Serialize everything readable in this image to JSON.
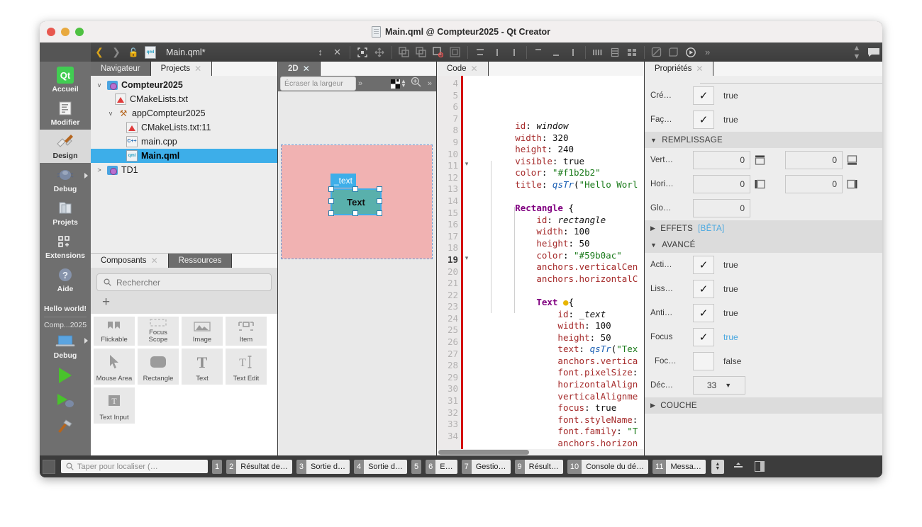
{
  "window": {
    "title": "Main.qml @ Compteur2025 - Qt Creator",
    "traffic": [
      "close",
      "minimize",
      "zoom"
    ]
  },
  "toolbar": {
    "back_icon": "chevron-left-icon",
    "forward_icon": "chevron-right-icon",
    "lock_icon": "unlock-icon",
    "file_icon": "qml-file-icon",
    "filename": "Main.qml*",
    "split_icon": "split-icon",
    "close_icon": "close-icon",
    "icons": [
      "fit-to-view-icon",
      "move-icon",
      "copy-format-icon",
      "paste-format-icon",
      "reset-position-icon",
      "reset-size-icon",
      "align-top-icon",
      "align-vertical-center-icon",
      "align-bottom-icon",
      "distribute-top-icon",
      "distribute-center-icon",
      "distribute-bottom-icon",
      "column-layout-icon",
      "row-layout-icon",
      "grid-layout-icon",
      "edit-annotation-icon",
      "add-state-icon",
      "preview-icon",
      "more-icon",
      "updown-icon",
      "comment-icon"
    ]
  },
  "modebar": {
    "items": [
      {
        "label": "Accueil",
        "icon": "qt-logo-icon",
        "active": false
      },
      {
        "label": "Modifier",
        "icon": "edit-mode-icon",
        "active": false
      },
      {
        "label": "Design",
        "icon": "design-mode-icon",
        "active": true
      },
      {
        "label": "Debug",
        "icon": "debug-mode-icon",
        "active": false
      },
      {
        "label": "Projets",
        "icon": "projects-mode-icon",
        "active": false
      },
      {
        "label": "Extensions",
        "icon": "extensions-mode-icon",
        "active": false
      },
      {
        "label": "Aide",
        "icon": "help-mode-icon",
        "active": false
      }
    ],
    "kit_target": "Hello world!",
    "kit_project": "Comp...2025",
    "run_config": "Debug",
    "run_icon": "run-icon",
    "debug_icon": "run-debug-icon",
    "build_icon": "build-hammer-icon",
    "desktop_icon": "desktop-target-icon"
  },
  "leftdock": {
    "tabs": [
      {
        "label": "Navigateur",
        "selected": false
      },
      {
        "label": "Projects",
        "selected": true
      }
    ],
    "tree": [
      {
        "label": "Compteur2025",
        "indent": 0,
        "twisty": "v",
        "icon": "project-folder-icon",
        "bold": true,
        "selected": false
      },
      {
        "label": "CMakeLists.txt",
        "indent": 1,
        "twisty": "",
        "icon": "cmake-file-icon",
        "bold": false,
        "selected": false
      },
      {
        "label": "appCompteur2025",
        "indent": 1,
        "twisty": "v",
        "icon": "build-target-icon",
        "bold": false,
        "selected": false
      },
      {
        "label": "CMakeLists.txt:11",
        "indent": 2,
        "twisty": "",
        "icon": "cmake-file-icon",
        "bold": false,
        "selected": false
      },
      {
        "label": "main.cpp",
        "indent": 2,
        "twisty": "",
        "icon": "cpp-file-icon",
        "bold": false,
        "selected": false
      },
      {
        "label": "Main.qml",
        "indent": 2,
        "twisty": "",
        "icon": "qml-file-icon",
        "bold": false,
        "selected": true
      },
      {
        "label": "TD1",
        "indent": 0,
        "twisty": ">",
        "icon": "project-folder-icon",
        "bold": false,
        "selected": false
      }
    ]
  },
  "components": {
    "tabs": [
      {
        "label": "Composants",
        "selected": true
      },
      {
        "label": "Ressources",
        "selected": false
      }
    ],
    "search_placeholder": "Rechercher",
    "search_icon": "search-icon",
    "add_icon": "plus-icon",
    "items": [
      {
        "label": "Flickable",
        "icon": "flickable-icon",
        "clipped": true
      },
      {
        "label": "Focus\nScope",
        "icon": "focus-scope-icon",
        "clipped": true
      },
      {
        "label": "Image",
        "icon": "image-icon",
        "clipped": true
      },
      {
        "label": "Item",
        "icon": "item-icon",
        "clipped": true
      },
      {
        "label": "Mouse Area",
        "icon": "mouse-area-icon",
        "clipped": false
      },
      {
        "label": "Rectangle",
        "icon": "rectangle-icon",
        "clipped": false
      },
      {
        "label": "Text",
        "icon": "text-icon",
        "clipped": false
      },
      {
        "label": "Text Edit",
        "icon": "text-edit-icon",
        "clipped": false
      },
      {
        "label": "Text Input",
        "icon": "text-input-icon",
        "clipped": false
      }
    ]
  },
  "view2d": {
    "tab_label": "2D",
    "close_icon": "close-icon",
    "override_width_placeholder": "Écraser la largeur",
    "more_icon": "chevron-double-right-icon",
    "background_icon": "checkerboard-icon",
    "zoom_icon": "zoom-in-icon",
    "canvas": {
      "root_color": "#f1b2b2",
      "selected_id": "_text",
      "selected_text": "Text",
      "selected_color": "#59b0ac",
      "selection_color": "#3daee9"
    }
  },
  "code": {
    "tab_label": "Code",
    "close_icon": "close-icon",
    "current_line": 19,
    "lines": [
      {
        "n": 4,
        "fold": "",
        "html": "        <span class='prop'>id</span>: <span class='idv'>window</span>"
      },
      {
        "n": 5,
        "fold": "",
        "html": "        <span class='prop'>width</span>: <span class='num'>320</span>"
      },
      {
        "n": 6,
        "fold": "",
        "html": "        <span class='prop'>height</span>: <span class='num'>240</span>"
      },
      {
        "n": 7,
        "fold": "",
        "html": "        <span class='prop'>visible</span>: <span class='num'>true</span>"
      },
      {
        "n": 8,
        "fold": "",
        "html": "        <span class='prop'>color</span>: <span class='str'>\"#f1b2b2\"</span>"
      },
      {
        "n": 9,
        "fold": "",
        "html": "        <span class='prop'>title</span>: <span class='fn'>qsTr</span>(<span class='str'>\"Hello Worl</span>"
      },
      {
        "n": 10,
        "fold": "",
        "html": ""
      },
      {
        "n": 11,
        "fold": "v",
        "html": "        <span class='kw'>Rectangle</span> {"
      },
      {
        "n": 12,
        "fold": "",
        "html": "            <span class='prop'>id</span>: <span class='idv'>rectangle</span>"
      },
      {
        "n": 13,
        "fold": "",
        "html": "            <span class='prop'>width</span>: <span class='num'>100</span>"
      },
      {
        "n": 14,
        "fold": "",
        "html": "            <span class='prop'>height</span>: <span class='num'>50</span>"
      },
      {
        "n": 15,
        "fold": "",
        "html": "            <span class='prop'>color</span>: <span class='str'>\"#59b0ac\"</span>"
      },
      {
        "n": 16,
        "fold": "",
        "html": "            <span class='prop'>anchors.verticalCen</span>"
      },
      {
        "n": 17,
        "fold": "",
        "html": "            <span class='prop'>anchors.horizontalC</span>"
      },
      {
        "n": 18,
        "fold": "",
        "html": ""
      },
      {
        "n": 19,
        "fold": "v",
        "html": "            <span class='kw'>Text</span> <span style='color:#e8b500'>●</span>{"
      },
      {
        "n": 20,
        "fold": "",
        "html": "                <span class='prop'>id</span>: <span class='idv'>_text</span>"
      },
      {
        "n": 21,
        "fold": "",
        "html": "                <span class='prop'>width</span>: <span class='num'>100</span>"
      },
      {
        "n": 22,
        "fold": "",
        "html": "                <span class='prop'>height</span>: <span class='num'>50</span>"
      },
      {
        "n": 23,
        "fold": "",
        "html": "                <span class='prop'>text</span>: <span class='fn'>qsTr</span>(<span class='str'>\"Tex</span>"
      },
      {
        "n": 24,
        "fold": "",
        "html": "                <span class='prop'>anchors.vertica</span>"
      },
      {
        "n": 25,
        "fold": "",
        "html": "                <span class='prop'>font.pixelSize</span>:"
      },
      {
        "n": 26,
        "fold": "",
        "html": "                <span class='prop'>horizontalAlign</span>"
      },
      {
        "n": 27,
        "fold": "",
        "html": "                <span class='prop'>verticalAlignme</span>"
      },
      {
        "n": 28,
        "fold": "",
        "html": "                <span class='prop'>focus</span>: <span class='num'>true</span>"
      },
      {
        "n": 29,
        "fold": "",
        "html": "                <span class='prop'>font.styleName</span>:"
      },
      {
        "n": 30,
        "fold": "",
        "html": "                <span class='prop'>font.family</span>: <span class='str'>\"T</span>"
      },
      {
        "n": 31,
        "fold": "",
        "html": "                <span class='prop'>anchors.horizon</span>"
      },
      {
        "n": 32,
        "fold": "",
        "html": "            }"
      },
      {
        "n": 33,
        "fold": "",
        "html": "        }"
      },
      {
        "n": 34,
        "fold": "",
        "html": ""
      }
    ]
  },
  "properties": {
    "tab_label": "Propriétés",
    "close_icon": "close-icon",
    "rows_top": [
      {
        "label": "Cré…",
        "checked": true,
        "value": "true",
        "highlight": false
      },
      {
        "label": "Faç…",
        "checked": true,
        "value": "true",
        "highlight": false
      }
    ],
    "section_padding": {
      "title": "REMPLISSAGE",
      "expanded": true,
      "caret": "▼"
    },
    "padding_rows": [
      {
        "label": "Vert…",
        "left_value": "0",
        "left_icon": "padding-top-icon",
        "right_value": "0",
        "right_icon": "padding-bottom-icon"
      },
      {
        "label": "Hori…",
        "left_value": "0",
        "left_icon": "padding-left-icon",
        "right_value": "0",
        "right_icon": "padding-right-icon"
      }
    ],
    "global_padding": {
      "label": "Glo…",
      "value": "0"
    },
    "section_effects": {
      "title": "EFFETS",
      "badge": "[BÊTA]",
      "expanded": false,
      "caret": "▶"
    },
    "section_advanced": {
      "title": "AVANCÉ",
      "expanded": true,
      "caret": "▼"
    },
    "rows_advanced": [
      {
        "label": "Acti…",
        "checked": true,
        "value": "true",
        "highlight": false
      },
      {
        "label": "Liss…",
        "checked": true,
        "value": "true",
        "highlight": false
      },
      {
        "label": "Anti…",
        "checked": true,
        "value": "true",
        "highlight": false
      },
      {
        "label": "Focus",
        "checked": true,
        "value": "true",
        "highlight": true
      },
      {
        "label": "Foc…",
        "checked": false,
        "value": "false",
        "highlight": false
      }
    ],
    "stack_row": {
      "label": "Déc…",
      "value": "33",
      "dropdown_icon": "chevron-down-icon"
    },
    "section_layer": {
      "title": "COUCHE",
      "expanded": false,
      "caret": "▶"
    }
  },
  "statusbar": {
    "toggle_left_icon": "toggle-sidebar-icon",
    "locate_icon": "search-icon",
    "locate_placeholder": "Taper pour localiser (…",
    "panes": [
      {
        "num": "1",
        "name": ""
      },
      {
        "num": "2",
        "name": "Résultat de…"
      },
      {
        "num": "3",
        "name": "Sortie d…"
      },
      {
        "num": "4",
        "name": "Sortie d…"
      },
      {
        "num": "5",
        "name": ""
      },
      {
        "num": "6",
        "name": "E…"
      },
      {
        "num": "7",
        "name": "Gestio…"
      },
      {
        "num": "9",
        "name": "Résult…"
      },
      {
        "num": "10",
        "name": "Console du dé…"
      },
      {
        "num": "11",
        "name": "Messa…"
      }
    ],
    "spin_icon": "updown-icon",
    "resize_icon": "resize-pane-icon",
    "toggle_right_icon": "toggle-rightbar-icon"
  },
  "colors": {
    "accent_blue": "#3daee9",
    "tab_2d": "#1ea7c5",
    "root_pink": "#f1b2b2",
    "rect_teal": "#59b0ac",
    "error_red": "#d40000"
  }
}
